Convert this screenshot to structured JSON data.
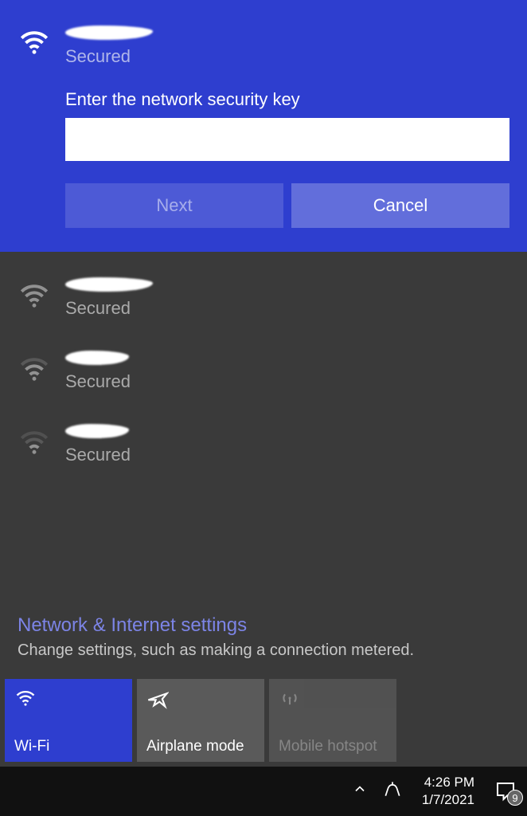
{
  "selected": {
    "name": "",
    "status": "Secured",
    "prompt": "Enter the network security key",
    "input_value": "",
    "next_label": "Next",
    "cancel_label": "Cancel"
  },
  "networks": [
    {
      "name": "",
      "status": "Secured"
    },
    {
      "name": "",
      "status": "Secured"
    },
    {
      "name": "",
      "status": "Secured"
    }
  ],
  "settings": {
    "title": "Network & Internet settings",
    "desc": "Change settings, such as making a connection metered."
  },
  "tiles": {
    "wifi": "Wi-Fi",
    "airplane": "Airplane mode",
    "hotspot": "Mobile hotspot"
  },
  "taskbar": {
    "time": "4:26 PM",
    "date": "1/7/2021",
    "notif_count": "9"
  }
}
